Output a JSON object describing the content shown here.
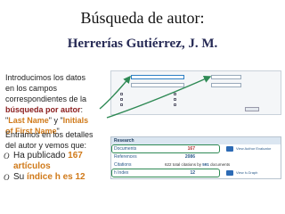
{
  "slide": {
    "title": "Búsqueda de autor:",
    "subtitle": "Herrerías Gutiérrez,  J. M."
  },
  "intro": {
    "lines": [
      "Introducimos los datos",
      "en los campos",
      "correspondientes de la"
    ],
    "highlight": "búsqueda por autor",
    "colon": ":",
    "field1": "Last Name",
    "and": "y",
    "field2": "Initials",
    "field2b": "of First Name",
    "quote": "\""
  },
  "detail": {
    "line1": "Entramos en los detalles",
    "line2": "del autor y vemos que:"
  },
  "bullets": [
    {
      "marker": "O",
      "pre": "Ha publicado ",
      "num": "167",
      "post": "artículos"
    },
    {
      "marker": "O",
      "pre": "Su ",
      "em": "índice h es 12"
    }
  ],
  "research": {
    "header": "Research",
    "rows": [
      {
        "label": "Documents",
        "value": "167",
        "link": "View Author Evaluator"
      },
      {
        "label": "References",
        "value": "2086"
      },
      {
        "label": "Citations",
        "value": "622",
        "cite_pre": "622 total citations by",
        "cite_num": "591",
        "cite_post": "documents"
      },
      {
        "label": "h Index",
        "value": "12",
        "link": "View h-Graph"
      }
    ]
  },
  "colors": {
    "accent_red": "#8a1c1c",
    "accent_orange": "#d07a1a",
    "highlight_box": "#2f8a55",
    "link_blue": "#2a5a8a"
  }
}
